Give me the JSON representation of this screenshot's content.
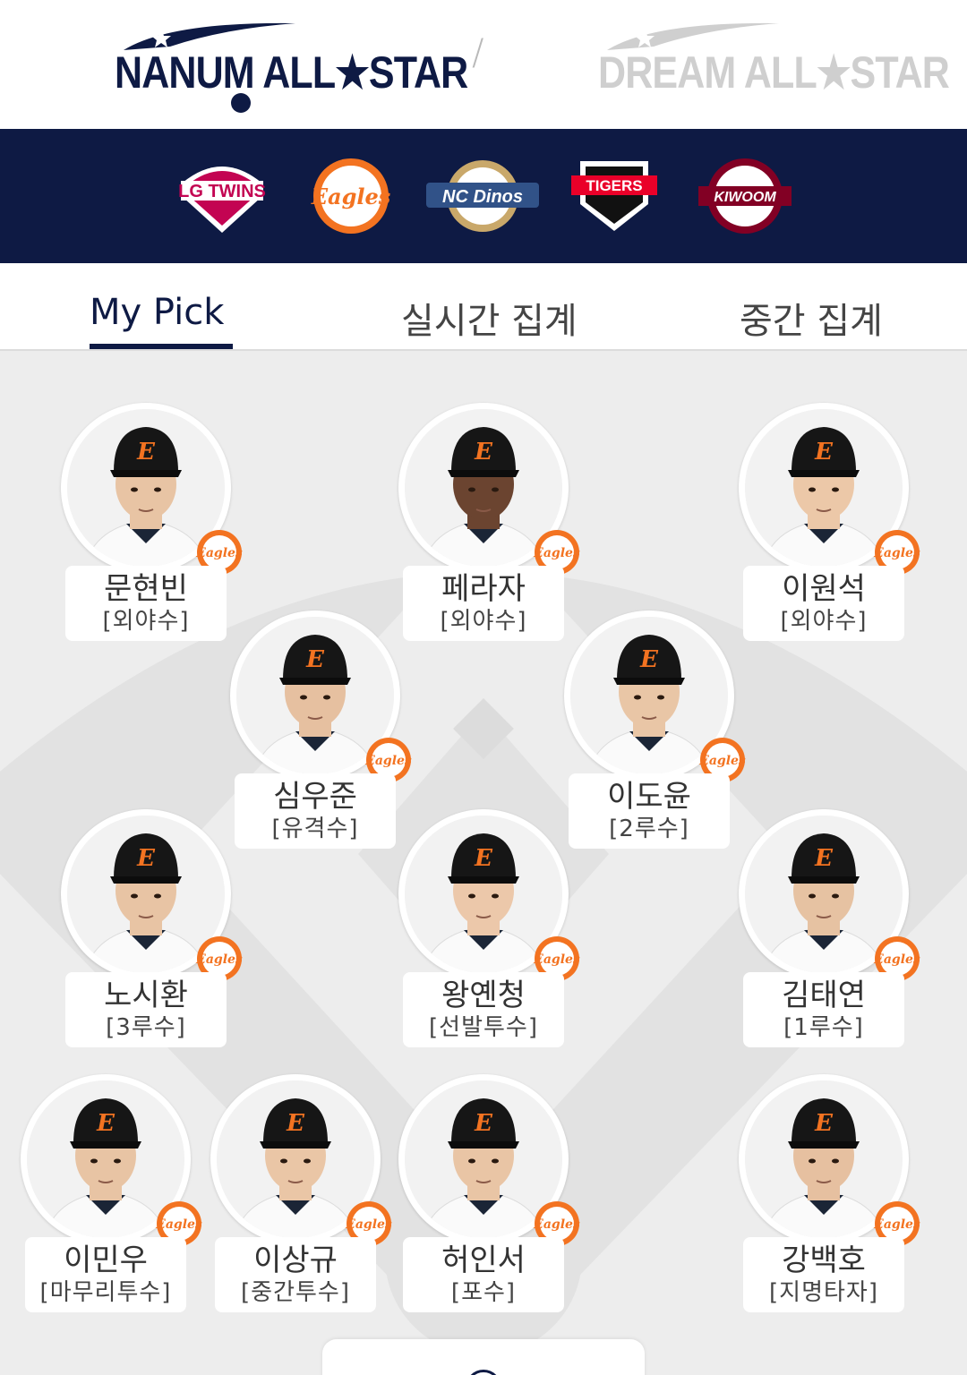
{
  "header": {
    "leagues": [
      {
        "label": "NANUM ALL★STAR",
        "active": true
      },
      {
        "label": "DREAM ALL★STAR",
        "active": false
      }
    ],
    "separator": "/"
  },
  "teams": [
    {
      "name": "LG TWINS",
      "icon": "lg-twins-logo"
    },
    {
      "name": "Eagles",
      "icon": "hanwha-eagles-logo"
    },
    {
      "name": "NC Dinos",
      "icon": "nc-dinos-logo"
    },
    {
      "name": "TIGERS",
      "icon": "kia-tigers-logo"
    },
    {
      "name": "KIWOOM",
      "icon": "kiwoom-heroes-logo"
    }
  ],
  "tabs": [
    {
      "label": "My Pick",
      "active": true
    },
    {
      "label": "실시간 집계",
      "active": false
    },
    {
      "label": "중간 집계",
      "active": false
    }
  ],
  "players": [
    {
      "name": "문현빈",
      "position": "[외야수]",
      "team": "Eagles"
    },
    {
      "name": "페라자",
      "position": "[외야수]",
      "team": "Eagles"
    },
    {
      "name": "이원석",
      "position": "[외야수]",
      "team": "Eagles"
    },
    {
      "name": "심우준",
      "position": "[유격수]",
      "team": "Eagles"
    },
    {
      "name": "이도윤",
      "position": "[2루수]",
      "team": "Eagles"
    },
    {
      "name": "노시환",
      "position": "[3루수]",
      "team": "Eagles"
    },
    {
      "name": "왕옌청",
      "position": "[선발투수]",
      "team": "Eagles"
    },
    {
      "name": "김태연",
      "position": "[1루수]",
      "team": "Eagles"
    },
    {
      "name": "이민우",
      "position": "[마무리투수]",
      "team": "Eagles"
    },
    {
      "name": "이상규",
      "position": "[중간투수]",
      "team": "Eagles"
    },
    {
      "name": "허인서",
      "position": "[포수]",
      "team": "Eagles"
    },
    {
      "name": "강백호",
      "position": "[지명타자]",
      "team": "Eagles"
    }
  ],
  "colors": {
    "navy": "#0e1a44",
    "eagles_orange": "#f37321",
    "field_gray": "#ededed"
  }
}
